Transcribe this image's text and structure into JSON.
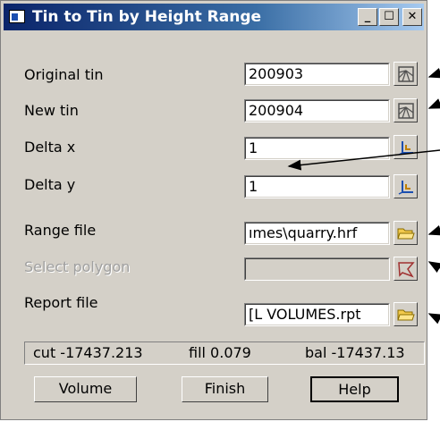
{
  "window": {
    "title": "Tin to Tin by Height Range"
  },
  "fields": [
    {
      "label": "Original tin",
      "value": "200903",
      "icon": "tin-select-icon"
    },
    {
      "label": "New tin",
      "value": "200904",
      "icon": "tin-select-icon"
    },
    {
      "label": "Delta x",
      "value": "1",
      "icon": "delta-pick-icon"
    },
    {
      "label": "Delta y",
      "value": "1",
      "icon": "delta-pick-icon"
    },
    {
      "label": "Range file",
      "value": "ımes\\quarry.hrf",
      "icon": "folder-icon"
    },
    {
      "label": "Select polygon",
      "value": "",
      "icon": "polygon-select-icon"
    },
    {
      "label": "Report file",
      "value": "[L VOLUMES.rpt",
      "icon": "folder-icon"
    }
  ],
  "status": {
    "cut": "cut -17437.213",
    "fill": "fill 0.079",
    "bal": "bal -17437.13"
  },
  "buttons": {
    "volume": "Volume",
    "finish": "Finish",
    "help": "Help"
  }
}
